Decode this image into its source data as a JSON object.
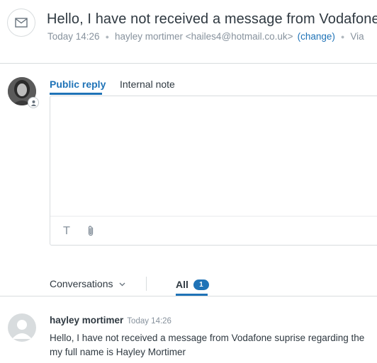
{
  "ticket": {
    "subject": "Hello, I have not received a message from Vodafone",
    "time": "Today 14:26",
    "requester": "hayley mortimer <hailes4@hotmail.co.uk>",
    "change_link": "(change)",
    "via": "Via"
  },
  "composer": {
    "tabs": [
      {
        "label": "Public reply",
        "active": true
      },
      {
        "label": "Internal note",
        "active": false
      }
    ],
    "toolbar": {
      "text_format_icon": "T",
      "attach_icon": "paperclip-icon"
    }
  },
  "conversation": {
    "filter_label": "Conversations",
    "all_tab_label": "All",
    "count": "1"
  },
  "message": {
    "author": "hayley mortimer",
    "time": "Today 14:26",
    "line1": "Hello, I have not received a message from Vodafone suprise regarding the",
    "line2": "my full name is Hayley Mortimer"
  },
  "colors": {
    "accent": "#1f73b7",
    "text": "#2f3941",
    "muted": "#87929d",
    "border": "#d8dcde"
  }
}
